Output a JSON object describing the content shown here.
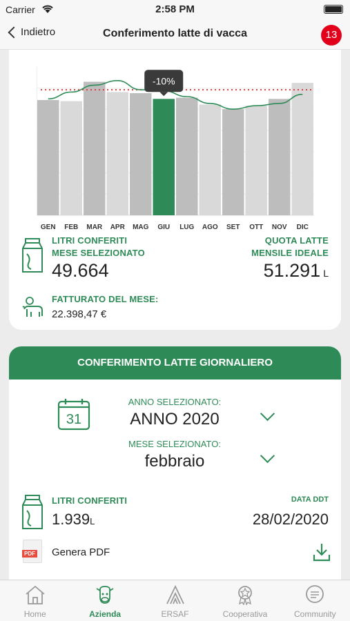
{
  "status_bar": {
    "carrier": "Carrier",
    "time": "2:58 PM"
  },
  "nav": {
    "back_label": "Indietro",
    "title": "Conferimento latte di vacca",
    "badge_count": "13"
  },
  "chart_data": {
    "type": "bar",
    "categories": [
      "GEN",
      "FEB",
      "MAR",
      "APR",
      "MAG",
      "GIU",
      "LUG",
      "AGO",
      "SET",
      "OTT",
      "NOV",
      "DIC"
    ],
    "values": [
      50.5,
      50.0,
      58.5,
      54.0,
      53.5,
      51.0,
      51.5,
      48.5,
      46.5,
      48.0,
      51.0,
      58.0
    ],
    "selected_index": 5,
    "selected_color": "#2e8b57",
    "bar_color": "#bdbdbd",
    "reference_line": 55.0,
    "reference_color": "#e53935",
    "curve_values": [
      51.0,
      54.0,
      57.0,
      59.0,
      55.0,
      54.5,
      52.0,
      49.0,
      46.5,
      48.0,
      49.0,
      53.0
    ],
    "curve_color": "#2e8b57",
    "tooltip": "-10%",
    "ylim": [
      0,
      65
    ]
  },
  "summary": {
    "litri_label_1": "LITRI CONFERITI",
    "litri_label_2": "MESE SELEZIONATO",
    "litri_value": "49.664",
    "quota_label_1": "QUOTA LATTE",
    "quota_label_2": "MENSILE IDEALE",
    "quota_value": "51.291",
    "quota_unit": "L",
    "fatturato_label": "FATTURATO DEL MESE:",
    "fatturato_value": "22.398,47 €"
  },
  "daily": {
    "header": "CONFERIMENTO LATTE GIORNALIERO",
    "calendar_day": "31",
    "anno_label": "ANNO SELEZIONATO:",
    "anno_value": "ANNO 2020",
    "mese_label": "MESE SELEZIONATO:",
    "mese_value": "febbraio",
    "litri_label": "LITRI CONFERITI",
    "litri_value": "1.939",
    "litri_unit": "L",
    "ddt_label": "DATA DDT",
    "ddt_value": "28/02/2020",
    "pdf_badge": "PDF",
    "pdf_label": "Genera PDF"
  },
  "tabs": [
    {
      "label": "Home",
      "icon": "home-icon"
    },
    {
      "label": "Azienda",
      "icon": "cow-icon",
      "active": true
    },
    {
      "label": "ERSAF",
      "icon": "ersaf-icon"
    },
    {
      "label": "Cooperativa",
      "icon": "medal-icon"
    },
    {
      "label": "Community",
      "icon": "chat-icon"
    }
  ],
  "colors": {
    "accent": "#2e8b57",
    "badge": "#e3001b"
  }
}
